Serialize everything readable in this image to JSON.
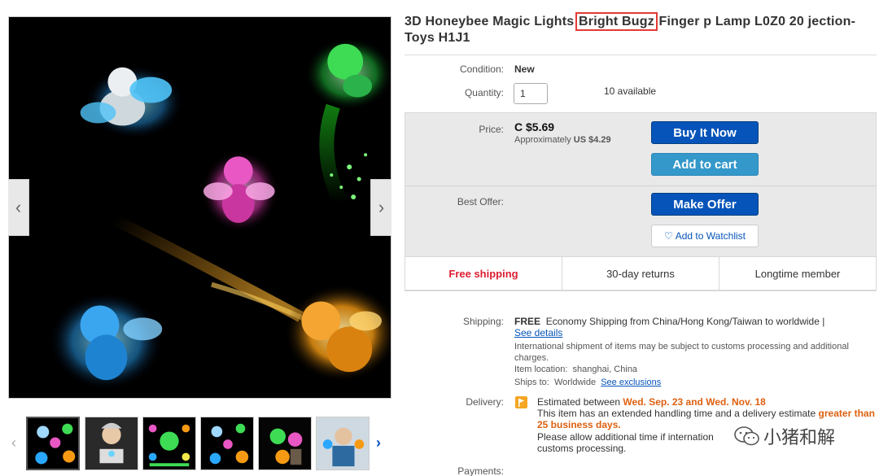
{
  "listing": {
    "title_before": "3D Honeybee Magic Lights ",
    "title_highlight": "Bright Bugz",
    "title_after": " Finger p Lamp L0Z0 20 jection-Toys H1J1"
  },
  "condition": {
    "label": "Condition:",
    "value": "New"
  },
  "quantity": {
    "label": "Quantity:",
    "value": "1",
    "available": "10 available"
  },
  "price": {
    "label": "Price:",
    "value": "C $5.69",
    "approx_prefix": "Approximately",
    "approx_value": "US $4.29"
  },
  "buttons": {
    "buy_now": "Buy It Now",
    "add_to_cart": "Add to cart",
    "make_offer": "Make Offer",
    "watchlist": "Add to Watchlist"
  },
  "best_offer": {
    "label": "Best Offer:"
  },
  "features": [
    "Free shipping",
    "30-day returns",
    "Longtime member"
  ],
  "shipping": {
    "label": "Shipping:",
    "free": "FREE",
    "method": "Economy Shipping from China/Hong Kong/Taiwan to worldwide |",
    "details_link": "See details",
    "customs_note": "International shipment of items may be subject to customs processing and additional charges.",
    "location_label": "Item location:",
    "location_value": "shanghai, China",
    "ships_to_label": "Ships to:",
    "ships_to_value": "Worldwide",
    "exclusions_link": "See exclusions"
  },
  "delivery": {
    "label": "Delivery:",
    "est_prefix": "Estimated between",
    "est_dates": "Wed. Sep. 23 and Wed. Nov. 18",
    "handling_text": "This item has an extended handling time and a delivery estimate",
    "handling_highlight": "greater than 25 business days.",
    "allow_text_1": "Please allow additional time if internation",
    "allow_text_2": "customs processing."
  },
  "payments": {
    "label": "Payments:"
  },
  "watermark": {
    "text": "小猪和解"
  },
  "colors": {
    "accent": "#0654ba",
    "secondary": "#3498ca",
    "free_shipping": "#dd1e31",
    "highlight_box": "#e53935",
    "orange": "#dd6010"
  },
  "gallery": {
    "thumbnails": [
      "thumb-bugs-1",
      "thumb-person-hand",
      "thumb-bug-circle",
      "thumb-bugs-2",
      "thumb-bugs-3",
      "thumb-person-hands"
    ]
  }
}
